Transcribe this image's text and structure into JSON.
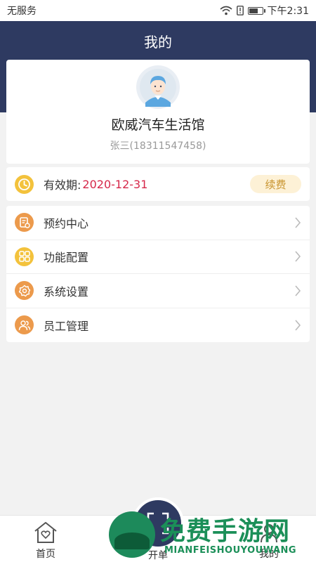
{
  "status_bar": {
    "carrier": "无服务",
    "time": "下午2:31",
    "battery_level": 0.75
  },
  "header": {
    "title": "我的"
  },
  "profile": {
    "shop_name": "欧威汽车生活馆",
    "user": "张三(18311547458)",
    "avatar_icon": "user-avatar-icon"
  },
  "validity": {
    "label": "有效期:",
    "date": "2020-12-31",
    "renew_label": "续费",
    "icon": "clock-icon"
  },
  "menu": {
    "items": [
      {
        "label": "预约中心",
        "icon": "appointment-icon",
        "color": "#ec9a4c"
      },
      {
        "label": "功能配置",
        "icon": "grid-config-icon",
        "color": "#f3c23c"
      },
      {
        "label": "系统设置",
        "icon": "gear-icon",
        "color": "#ec9a4c"
      },
      {
        "label": "员工管理",
        "icon": "staff-icon",
        "color": "#ec9a4c"
      }
    ]
  },
  "bottom_nav": {
    "home_label": "首页",
    "open_label": "开单",
    "mine_label": "我的"
  },
  "watermark": {
    "text": "免费手游网",
    "sub": "MIANFEISHOUYOUWANG"
  },
  "colors": {
    "header": "#2e3a61",
    "accent_red": "#d6284a",
    "renew_text": "#c99530"
  }
}
